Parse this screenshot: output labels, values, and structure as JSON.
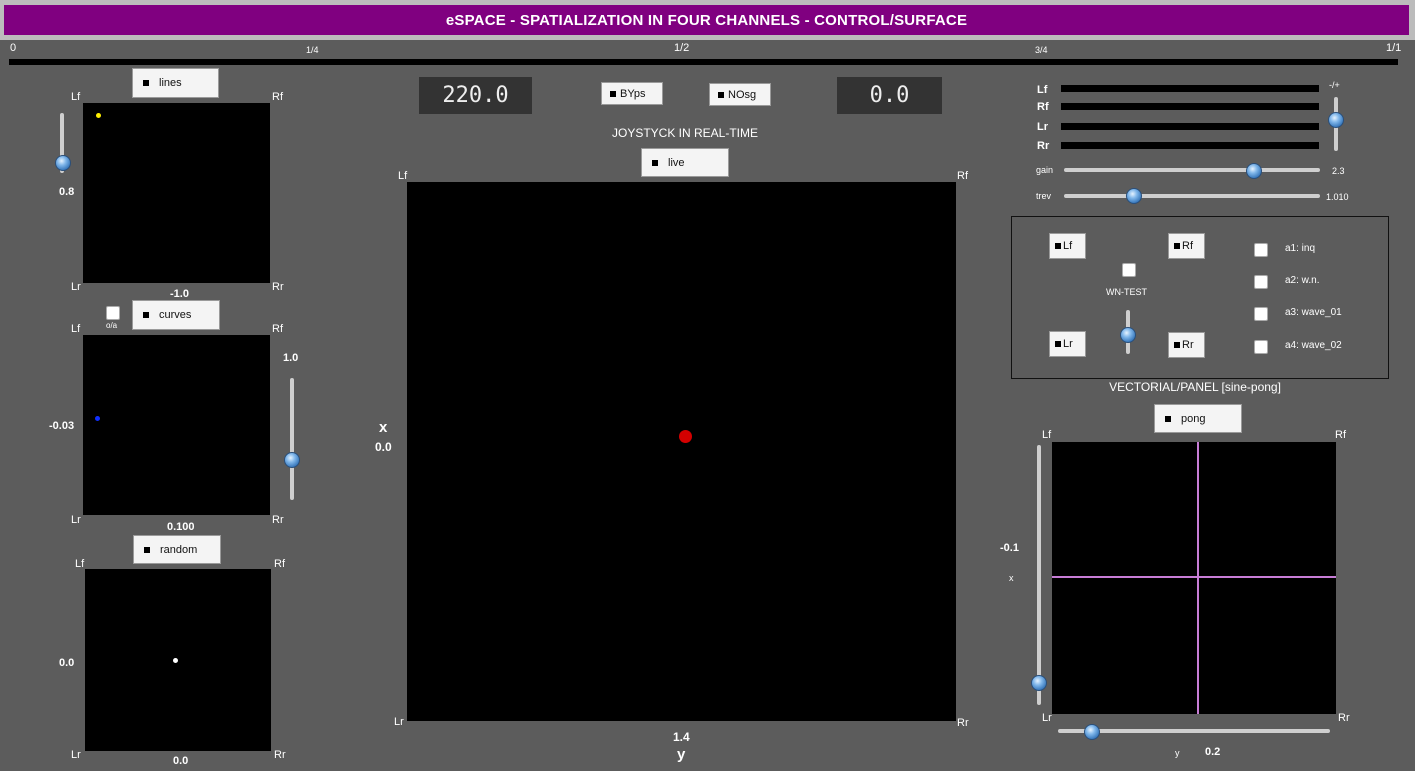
{
  "title": "eSPACE - SPATIALIZATION IN FOUR CHANNELS - CONTROL/SURFACE",
  "timeline": {
    "ticks": [
      "0",
      "1/4",
      "1/2",
      "3/4",
      "1/1"
    ]
  },
  "corners": {
    "lf": "Lf",
    "rf": "Rf",
    "lr": "Lr",
    "rr": "Rr"
  },
  "left": {
    "lines": {
      "button": "lines",
      "slider_value": "0.8",
      "slider_level": 0.8,
      "bottom_value": "-1.0"
    },
    "curves": {
      "button": "curves",
      "toggle_label": "o/a",
      "left_value": "-0.03",
      "right_value": "1.0",
      "slider_level": 0.3,
      "bottom_value": "0.100"
    },
    "random": {
      "button": "random",
      "left_value": "0.0",
      "bottom_value": "0.0"
    }
  },
  "center": {
    "number_left": "220.0",
    "number_right": "0.0",
    "bypass_button": "BYps",
    "nosg_button": "NOsg",
    "joystick_title": "JOYSTYCK IN REAL-TIME",
    "live_button": "live",
    "x_label": "x",
    "x_value": "0.0",
    "y_label": "y",
    "y_value": "1.4",
    "dot_color": "#d40000"
  },
  "right": {
    "meters": [
      "Lf",
      "Rf",
      "Lr",
      "Rr"
    ],
    "minus_plus": "-/+",
    "gain": {
      "label": "gain",
      "value": "2.3"
    },
    "trev": {
      "label": "trev",
      "value": "1.010"
    },
    "test": {
      "buttons": [
        "Lf",
        "Rf",
        "Lr",
        "Rr"
      ],
      "wn_test": "WN-TEST",
      "audio": [
        "a1: inq",
        "a2: w.n.",
        "a3: wave_01",
        "a4: wave_02"
      ]
    },
    "vectorial_title": "VECTORIAL/PANEL [sine-pong]",
    "pong_button": "pong",
    "x_value": "-0.1",
    "x_label": "x",
    "y_label": "y",
    "y_value": "0.2",
    "crosshair_color": "#c77dd6"
  }
}
